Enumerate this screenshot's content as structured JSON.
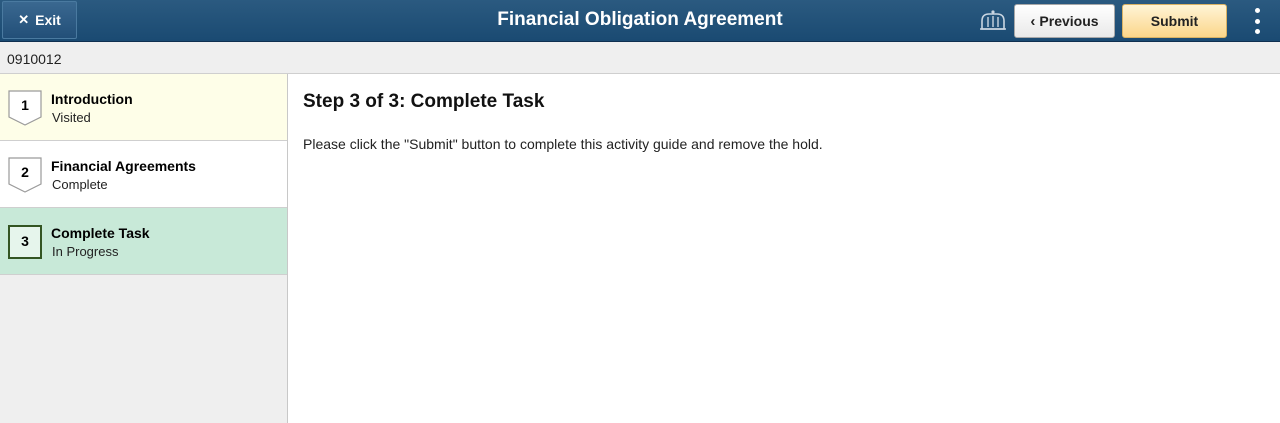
{
  "header": {
    "title": "Financial Obligation Agreement",
    "exit_label": "Exit",
    "previous_label": "Previous",
    "submit_label": "Submit",
    "nav_icon": "navbar-icon",
    "more_icon": "more-actions-icon"
  },
  "student_id": "0910012",
  "steps": [
    {
      "number": "1",
      "title": "Introduction",
      "status": "Visited"
    },
    {
      "number": "2",
      "title": "Financial Agreements",
      "status": "Complete"
    },
    {
      "number": "3",
      "title": "Complete Task",
      "status": "In Progress"
    }
  ],
  "main": {
    "heading": "Step 3 of 3: Complete Task",
    "instructions": "Please click the \"Submit\" button to complete this activity guide and remove the hold."
  },
  "colors": {
    "header": "#1f4f78",
    "submit": "#fbd68a",
    "visited_step": "#fefee8",
    "active_step": "#c8e9d8"
  }
}
